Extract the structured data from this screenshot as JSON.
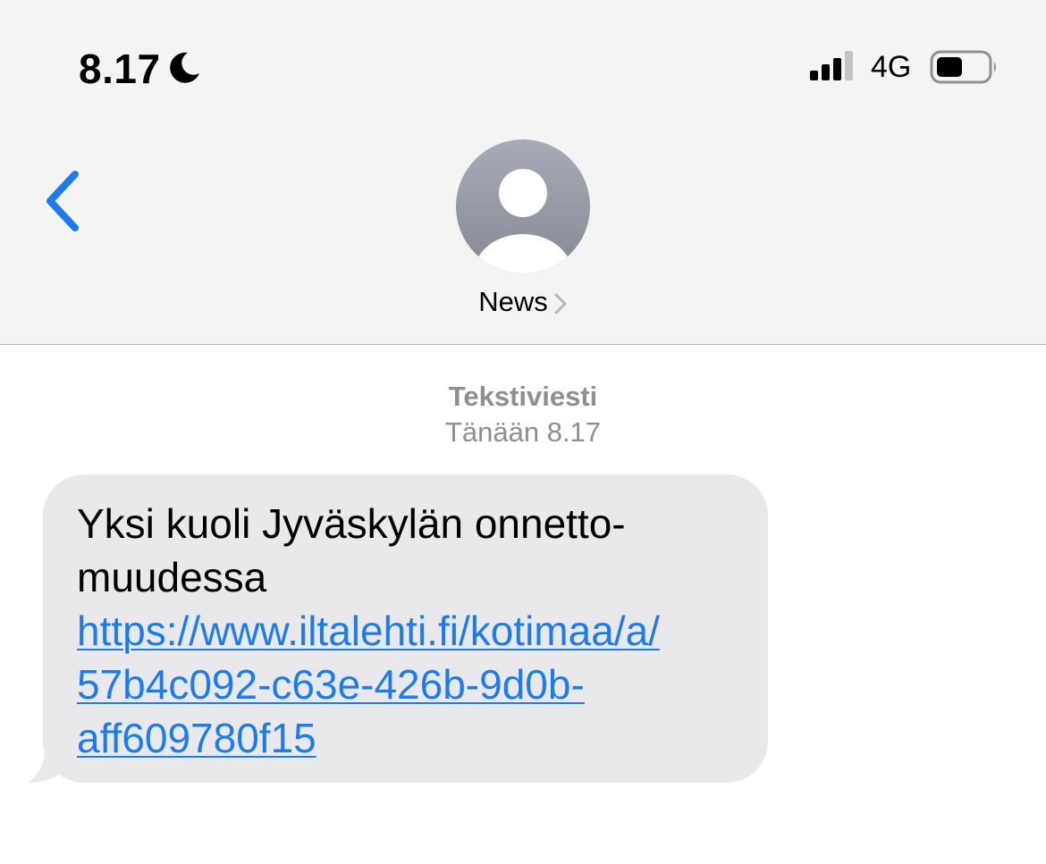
{
  "status_bar": {
    "time": "8.17",
    "focus_icon": "moon-icon",
    "signal_icon": "cellular-signal-icon",
    "network": "4G",
    "battery_icon": "battery-icon"
  },
  "conversation_header": {
    "back_icon": "chevron-left-icon",
    "avatar_icon": "person-silhouette-icon",
    "contact_name": "News",
    "contact_chevron_icon": "chevron-right-icon"
  },
  "message_meta": {
    "kind": "Tekstiviesti",
    "timestamp": "Tänään 8.17"
  },
  "messages": [
    {
      "text_line_1": "Yksi kuoli Jyväskylän onnetto-",
      "text_line_2": "muudessa",
      "link_line_1": "https://www.iltalehti.fi/kotimaa/a/",
      "link_line_2": "57b4c092-c63e-426b-9d0b-",
      "link_line_3": "aff609780f15"
    }
  ],
  "colors": {
    "accent": "#1b7cf2",
    "bubble_incoming": "#e9e9eb",
    "header_bg": "#f4f4f5",
    "meta_text": "#8e8e93"
  }
}
